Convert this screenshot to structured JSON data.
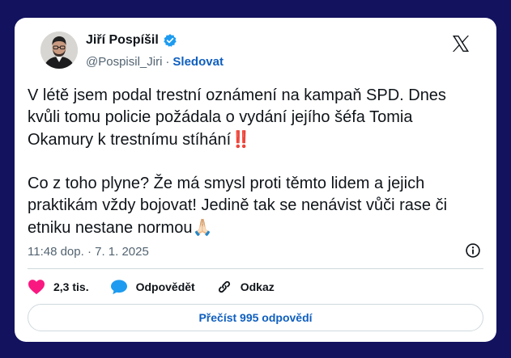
{
  "author": {
    "name": "Jiří Pospíšil",
    "handle": "@Pospisil_Jiri",
    "separator": "·",
    "follow_label": "Sledovat"
  },
  "tweet": {
    "paragraph1": "V létě jsem podal trestní oznámení na kampaň SPD. Dnes kvůli tomu policie požádala o vydání jejího šéfa Tomia Okamury k trestnímu stíhání",
    "paragraph1_emoji": "‼️",
    "paragraph2": "Co z toho plyne? Že má smysl proti těmto lidem a jejich praktikám vždy bojovat! Jedině tak se nenávist vůči rase či etniku nestane normou",
    "paragraph2_emoji": "🙏🏻",
    "timestamp": "11:48 dop. · 7. 1. 2025"
  },
  "actions": {
    "likes_count": "2,3 tis.",
    "reply_label": "Odpovědět",
    "link_label": "Odkaz"
  },
  "read_replies_label": "Přečíst 995 odpovědí",
  "colors": {
    "background": "#13125e",
    "like_red": "#f91880",
    "accent_blue": "#0f5fbf",
    "verified_blue": "#1d9bf0"
  },
  "icons": {
    "verified": "verified-badge-icon",
    "logo": "x-logo-icon",
    "info": "info-icon",
    "like": "heart-icon",
    "reply": "speech-bubble-icon",
    "link": "link-icon"
  }
}
